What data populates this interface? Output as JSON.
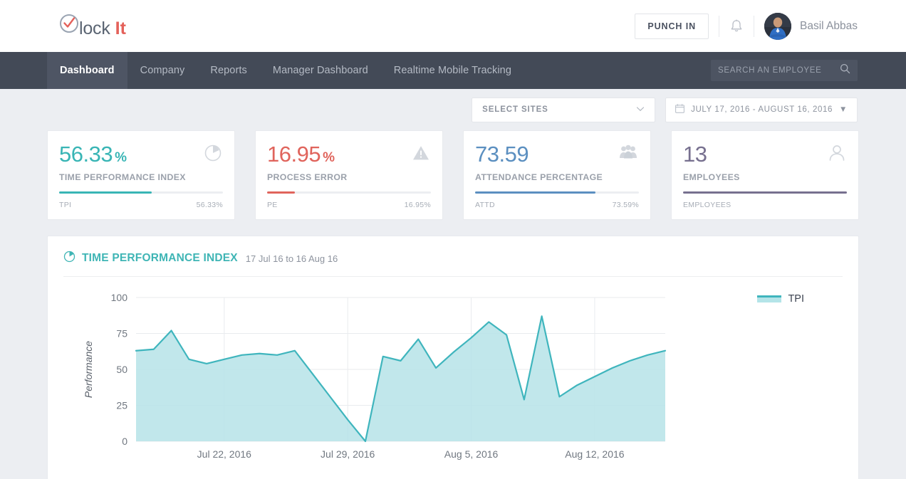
{
  "header": {
    "logo": {
      "main": "lock",
      "accent": "It",
      "icon": "circle-check-icon"
    },
    "punch_in_label": "PUNCH IN",
    "bell_icon": "bell-icon",
    "user_name": "Basil Abbas",
    "avatar_icon": "user-avatar-photo"
  },
  "nav": {
    "items": [
      {
        "label": "Dashboard",
        "active": true
      },
      {
        "label": "Company",
        "active": false
      },
      {
        "label": "Reports",
        "active": false
      },
      {
        "label": "Manager Dashboard",
        "active": false
      },
      {
        "label": "Realtime Mobile Tracking",
        "active": false
      }
    ],
    "search": {
      "placeholder": "SEARCH AN EMPLOYEE",
      "value": "",
      "icon": "search-icon"
    }
  },
  "filters": {
    "sites": {
      "label": "SELECT SITES",
      "icon": "chevron-down-icon"
    },
    "daterange": {
      "label": "JULY 17, 2016 - AUGUST 16, 2016",
      "icon": "calendar-icon",
      "caret": "▼"
    }
  },
  "cards": [
    {
      "value": "56.33",
      "unit": "%",
      "label": "TIME PERFORMANCE INDEX",
      "icon": "pie-chart-icon",
      "color": "#39b5b5",
      "bar_key": "TPI",
      "bar_value": "56.33%",
      "bar_percent": 56.33
    },
    {
      "value": "16.95",
      "unit": "%",
      "label": "PROCESS ERROR",
      "icon": "warning-triangle-icon",
      "color": "#e0645c",
      "bar_key": "PE",
      "bar_value": "16.95%",
      "bar_percent": 16.95
    },
    {
      "value": "73.59",
      "unit": "",
      "label": "ATTENDANCE PERCENTAGE",
      "icon": "people-group-icon",
      "color": "#5b8fc0",
      "bar_key": "ATTD",
      "bar_value": "73.59%",
      "bar_percent": 73.59
    },
    {
      "value": "13",
      "unit": "",
      "label": "EMPLOYEES",
      "icon": "single-user-icon",
      "color": "#77708f",
      "bar_key": "EMPLOYEES",
      "bar_value": "",
      "bar_percent": 100
    }
  ],
  "panel": {
    "icon": "pie-chart-icon",
    "title": "TIME PERFORMANCE INDEX",
    "subtitle": "17 Jul 16 to 16 Aug 16"
  },
  "chart_data": {
    "type": "area",
    "title": "TIME PERFORMANCE INDEX",
    "xlabel": "",
    "ylabel": "Performance",
    "ylim": [
      0,
      100
    ],
    "yticks": [
      0,
      25,
      50,
      75,
      100
    ],
    "xticks": [
      "Jul 22, 2016",
      "Jul 29, 2016",
      "Aug 5, 2016",
      "Aug 12, 2016"
    ],
    "xtick_indices": [
      5,
      12,
      19,
      26
    ],
    "grid": true,
    "legend": "TPI",
    "legend_position": "right",
    "line_color": "#3fb5bd",
    "fill_color": "#b6e3e8",
    "x": [
      "Jul 17, 2016",
      "Jul 18, 2016",
      "Jul 19, 2016",
      "Jul 20, 2016",
      "Jul 21, 2016",
      "Jul 22, 2016",
      "Jul 23, 2016",
      "Jul 24, 2016",
      "Jul 25, 2016",
      "Jul 26, 2016",
      "Jul 27, 2016",
      "Jul 28, 2016",
      "Jul 29, 2016",
      "Jul 30, 2016",
      "Jul 31, 2016",
      "Aug 1, 2016",
      "Aug 2, 2016",
      "Aug 3, 2016",
      "Aug 4, 2016",
      "Aug 5, 2016",
      "Aug 6, 2016",
      "Aug 7, 2016",
      "Aug 8, 2016",
      "Aug 9, 2016",
      "Aug 10, 2016",
      "Aug 11, 2016",
      "Aug 12, 2016",
      "Aug 13, 2016",
      "Aug 14, 2016",
      "Aug 15, 2016",
      "Aug 16, 2016"
    ],
    "series": [
      {
        "name": "TPI",
        "values": [
          63,
          64,
          77,
          57,
          54,
          57,
          60,
          61,
          60,
          63,
          47,
          31,
          15,
          0,
          59,
          56,
          71,
          51,
          62,
          72,
          83,
          74,
          29,
          87,
          31,
          39,
          45,
          51,
          56,
          60,
          63
        ]
      }
    ]
  }
}
